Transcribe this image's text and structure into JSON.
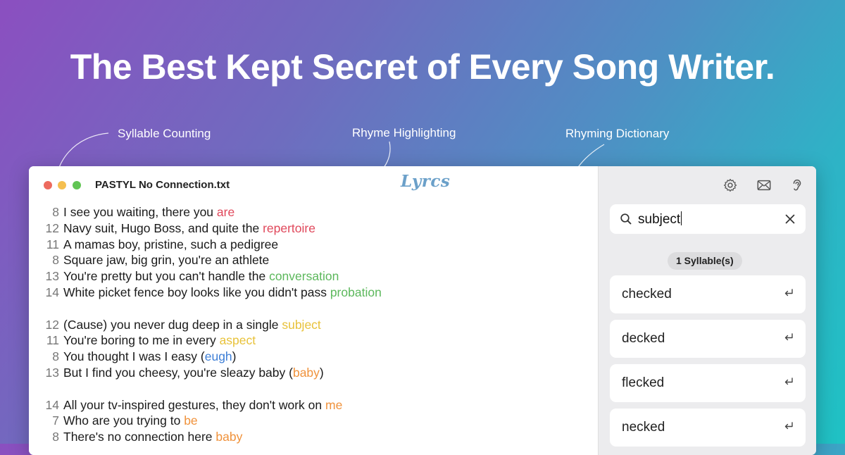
{
  "headline": "The Best Kept Secret of Every Song Writer.",
  "callouts": {
    "syllable": "Syllable Counting",
    "rhyme": "Rhyme Highlighting",
    "dictionary": "Rhyming Dictionary"
  },
  "window": {
    "title": "PASTYL No Connection.txt",
    "logo": "Lyrcs"
  },
  "colors": {
    "red": "#e0485b",
    "green": "#5cb85c",
    "yellow": "#e8c23a",
    "blue": "#3d7ed6",
    "orange": "#f0923b"
  },
  "lyrics": [
    {
      "n": "8",
      "pre": "I see you waiting, there you ",
      "hl": "are",
      "post": "",
      "color": "red"
    },
    {
      "n": "12",
      "pre": "Navy suit, Hugo Boss, and quite the ",
      "hl": "repertoire",
      "post": "",
      "color": "red"
    },
    {
      "n": "11",
      "pre": "A mamas boy, pristine, such a pedigree",
      "hl": "",
      "post": "",
      "color": ""
    },
    {
      "n": "8",
      "pre": "Square jaw, big grin, you're an athlete",
      "hl": "",
      "post": "",
      "color": ""
    },
    {
      "n": "13",
      "pre": "You're pretty but you can't handle the ",
      "hl": "conversation",
      "post": "",
      "color": "green"
    },
    {
      "n": "14",
      "pre": "White picket fence boy looks like you didn't pass ",
      "hl": "probation",
      "post": "",
      "color": "green"
    },
    {
      "blank": true
    },
    {
      "n": "12",
      "pre": "(Cause) you never dug deep in a single ",
      "hl": "subject",
      "post": "",
      "color": "yellow"
    },
    {
      "n": "11",
      "pre": "You're boring to me in every ",
      "hl": "aspect",
      "post": "",
      "color": "yellow"
    },
    {
      "n": "8",
      "pre": "You thought I was I easy (",
      "hl": "eugh",
      "post": ")",
      "color": "blue"
    },
    {
      "n": "13",
      "pre": "But I find you cheesy, you're sleazy baby (",
      "hl": "baby",
      "post": ")",
      "color": "orange"
    },
    {
      "blank": true
    },
    {
      "n": "14",
      "pre": "All your tv-inspired gestures, they don't work on ",
      "hl": "me",
      "post": "",
      "color": "orange"
    },
    {
      "n": "7",
      "pre": "Who are you trying to ",
      "hl": "be",
      "post": "",
      "color": "orange"
    },
    {
      "n": "8",
      "pre": "There's no connection here ",
      "hl": "baby",
      "post": "",
      "color": "orange"
    }
  ],
  "sidebar": {
    "icons": [
      "gear-icon",
      "envelope-icon",
      "ear-icon"
    ],
    "search": {
      "value": "subject"
    },
    "badge": "1 Syllable(s)",
    "results": [
      "checked",
      "decked",
      "flecked",
      "necked"
    ]
  }
}
